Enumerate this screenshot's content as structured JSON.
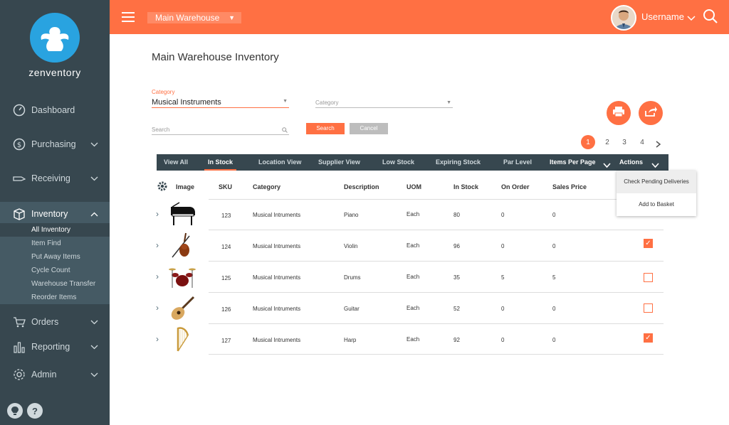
{
  "app": {
    "brand": "zenventory"
  },
  "sidebar": {
    "items": [
      {
        "label": "Dashboard",
        "icon": "dashboard-icon"
      },
      {
        "label": "Purchasing",
        "icon": "dollar-icon"
      },
      {
        "label": "Receiving",
        "icon": "receiving-icon"
      },
      {
        "label": "Inventory",
        "icon": "inventory-icon"
      },
      {
        "label": "Orders",
        "icon": "cart-icon"
      },
      {
        "label": "Reporting",
        "icon": "chart-icon"
      },
      {
        "label": "Admin",
        "icon": "gear-icon"
      }
    ],
    "subitems": [
      "All Inventory",
      "Item Find",
      "Put Away Items",
      "Cycle Count",
      "Warehouse Transfer",
      "Reorder Items"
    ]
  },
  "topbar": {
    "warehouse": "Main Warehouse",
    "username": "Username"
  },
  "page": {
    "title": "Main Warehouse Inventory"
  },
  "filters": {
    "category1_label": "Category",
    "category1_value": "Musical Instruments",
    "category2_placeholder": "Category",
    "search_placeholder": "Search",
    "search_button": "Search",
    "cancel_button": "Cancel"
  },
  "pagination": [
    "1",
    "2",
    "3",
    "4"
  ],
  "tabs": [
    "View All",
    "In Stock",
    "Location View",
    "Supplier View",
    "Low Stock",
    "Expiring Stock",
    "Par Level",
    "Items Per Page",
    "Actions"
  ],
  "actions_menu": [
    "Check Pending Deliveries",
    "Add to Basket"
  ],
  "table": {
    "headers": [
      "Image",
      "SKU",
      "Category",
      "Description",
      "UOM",
      "In Stock",
      "On Order",
      "Sales Price"
    ],
    "rows": [
      {
        "sku": "123",
        "category": "Musical Intruments",
        "description": "Piano",
        "uom": "Each",
        "in_stock": "80",
        "on_order": "0",
        "sales_price": "0",
        "checked": null
      },
      {
        "sku": "124",
        "category": "Musical Intruments",
        "description": "Violin",
        "uom": "Each",
        "in_stock": "96",
        "on_order": "0",
        "sales_price": "0",
        "checked": true
      },
      {
        "sku": "125",
        "category": "Musical Intruments",
        "description": "Drums",
        "uom": "Each",
        "in_stock": "35",
        "on_order": "5",
        "sales_price": "5",
        "checked": false
      },
      {
        "sku": "126",
        "category": "Musical Intruments",
        "description": "Guitar",
        "uom": "Each",
        "in_stock": "52",
        "on_order": "0",
        "sales_price": "0",
        "checked": false
      },
      {
        "sku": "127",
        "category": "Musical Intruments",
        "description": "Harp",
        "uom": "Each",
        "in_stock": "92",
        "on_order": "0",
        "sales_price": "0",
        "checked": true
      }
    ]
  },
  "colors": {
    "accent": "#ff7043",
    "sidebar": "#37474f",
    "logo": "#29a3e0"
  }
}
